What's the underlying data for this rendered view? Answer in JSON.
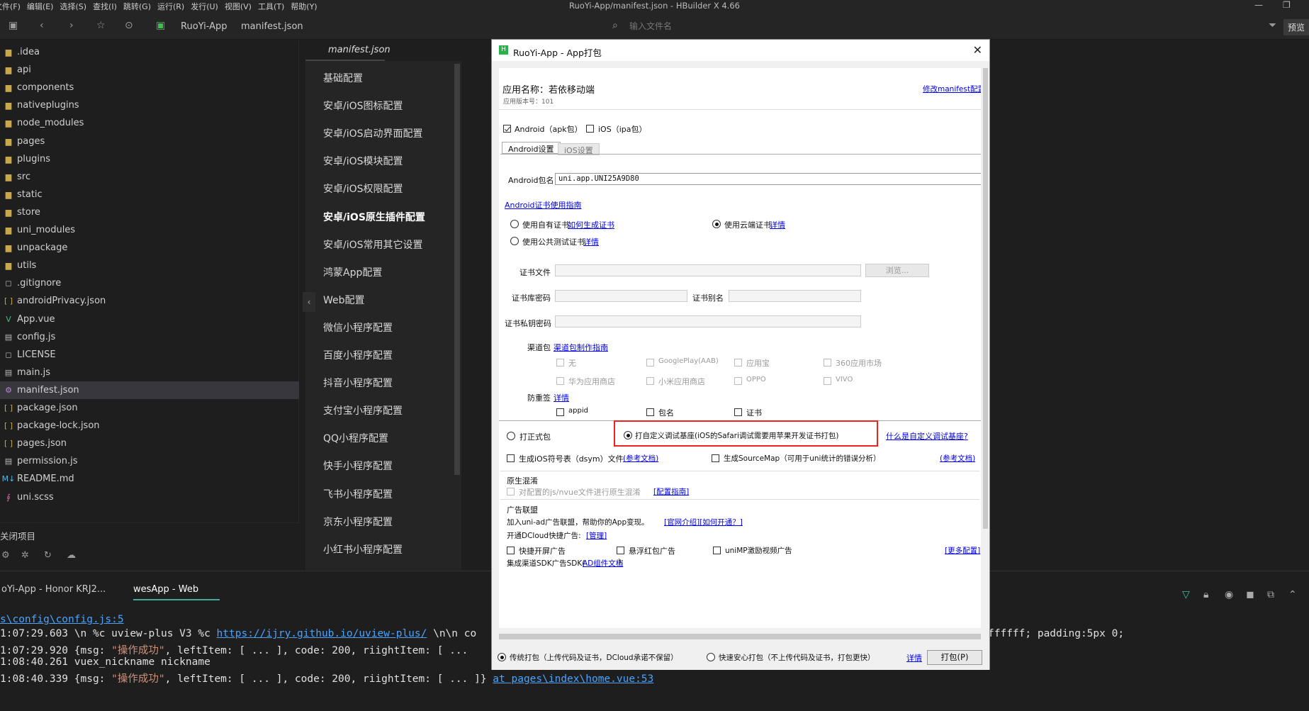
{
  "app": {
    "window_title": "RuoYi-App/manifest.json - HBuilder X 4.66",
    "menus": [
      "文件(F)",
      "编辑(E)",
      "选择(S)",
      "查找(I)",
      "跳转(G)",
      "运行(R)",
      "发行(U)",
      "视图(V)",
      "工具(T)",
      "帮助(Y)"
    ]
  },
  "toolbar": {
    "breadcrumb": [
      "RuoYi-App",
      "manifest.json"
    ],
    "search_placeholder": "输入文件名",
    "preview_label": "预览"
  },
  "sidebar": {
    "items": [
      {
        "name": ".idea",
        "icon": "folder-icon"
      },
      {
        "name": "api",
        "icon": "folder-icon"
      },
      {
        "name": "components",
        "icon": "folder-icon"
      },
      {
        "name": "nativeplugins",
        "icon": "folder-icon"
      },
      {
        "name": "node_modules",
        "icon": "folder-icon"
      },
      {
        "name": "pages",
        "icon": "folder-icon"
      },
      {
        "name": "plugins",
        "icon": "folder-icon"
      },
      {
        "name": "src",
        "icon": "folder-icon"
      },
      {
        "name": "static",
        "icon": "folder-icon"
      },
      {
        "name": "store",
        "icon": "folder-icon"
      },
      {
        "name": "uni_modules",
        "icon": "folder-icon"
      },
      {
        "name": "unpackage",
        "icon": "folder-icon"
      },
      {
        "name": "utils",
        "icon": "folder-icon"
      },
      {
        "name": ".gitignore",
        "icon": "file-icon"
      },
      {
        "name": "androidPrivacy.json",
        "icon": "json-icon"
      },
      {
        "name": "App.vue",
        "icon": "vue-icon"
      },
      {
        "name": "config.js",
        "icon": "js-icon"
      },
      {
        "name": "LICENSE",
        "icon": "file-icon"
      },
      {
        "name": "main.js",
        "icon": "js-icon"
      },
      {
        "name": "manifest.json",
        "icon": "manifest-icon"
      },
      {
        "name": "package.json",
        "icon": "json-icon"
      },
      {
        "name": "package-lock.json",
        "icon": "json-icon"
      },
      {
        "name": "pages.json",
        "icon": "json-icon"
      },
      {
        "name": "permission.js",
        "icon": "js-icon"
      },
      {
        "name": "README.md",
        "icon": "markdown-icon"
      },
      {
        "name": "uni.scss",
        "icon": "scss-icon"
      }
    ],
    "selected": "manifest.json",
    "footer_label": "关闭项目"
  },
  "editor": {
    "tab": "manifest.json",
    "nav": [
      "基础配置",
      "安卓/iOS图标配置",
      "安卓/iOS启动界面配置",
      "安卓/iOS模块配置",
      "安卓/iOS权限配置",
      "安卓/iOS原生插件配置",
      "安卓/iOS常用其它设置",
      "鸿蒙App配置",
      "Web配置",
      "微信小程序配置",
      "百度小程序配置",
      "抖音小程序配置",
      "支付宝小程序配置",
      "QQ小程序配置",
      "快手小程序配置",
      "飞书小程序配置",
      "京东小程序配置",
      "小红书小程序配置"
    ],
    "active_nav": "安卓/iOS原生插件配置"
  },
  "console": {
    "tabs": [
      "oYi-App - Honor KRJ2...",
      "wesApp - Web"
    ],
    "active_tab": "wesApp - Web",
    "lines": [
      {
        "prefix": "",
        "link": "s\\config\\config.js:5",
        "rest": ""
      },
      {
        "prefix": "1:07:29.603 \\n %c uview-plus V3 %c ",
        "link": "https://ijry.github.io/uview-plus/",
        "rest": " \\n\\n co"
      },
      {
        "prefix": "1:07:29.920 {msg: ",
        "str": "\"操作成功\"",
        "rest": ", leftItem: [ ... ], code: 200, riightItem: [ ..."
      },
      {
        "prefix": "1:08:40.261 vuex_nickname nickname",
        "link": "",
        "rest": ""
      },
      {
        "prefix": "1:08:40.339 {msg: ",
        "str": "\"操作成功\"",
        "rest": ", leftItem: [ ... ], code: 200, riightItem: [ ... ]} ",
        "link2": "at pages\\index\\home.vue:53"
      }
    ],
    "right_overflow": "ffffff; padding:5px 0;"
  },
  "dialog": {
    "title": "RuoYi-App - App打包",
    "app_name_label": "应用名称：若依移动端",
    "version_label": "应用版本号：101",
    "modify_link": "修改manifest配置",
    "platform_android": "Android（apk包）",
    "platform_ios": "iOS（ipa包）",
    "tab_android": "Android设置",
    "tab_ios": "iOS设置",
    "package_name_label": "Android包名",
    "package_name_value": "uni.app.UNI25A9D80",
    "cert_guide_link": "Android证书使用指南",
    "own_cert_label": "使用自有证书",
    "own_cert_link": "如何生成证书",
    "cloud_cert_label": "使用云端证书",
    "cloud_cert_link": "详情",
    "public_cert_label": "使用公共测试证书",
    "public_cert_link": "详情",
    "cert_file_label": "证书文件",
    "browse_label": "浏览...",
    "cert_pwd_label": "证书库密码",
    "cert_alias_label": "证书别名",
    "cert_key_label": "证书私钥密码",
    "channel_label": "渠道包",
    "channel_link": "渠道包制作指南",
    "channels": [
      "无",
      "GooglePlay(AAB)",
      "应用宝",
      "360应用市场",
      "华为应用商店",
      "小米应用商店",
      "OPPO",
      "VIVO"
    ],
    "antiresign_label": "防重签",
    "antiresign_link": "详情",
    "antiresign_opts": [
      "appid",
      "包名",
      "证书"
    ],
    "formal_label": "打正式包",
    "custom_base_label": "打自定义调试基座(iOS的Safari调试需要用苹果开发证书打包)",
    "custom_base_link": "什么是自定义调试基座?",
    "dsym_label": "生成iOS符号表（dsym）文件",
    "dsym_link": "(参考文档)",
    "sourcemap_label": "生成SourceMap（可用于uni统计的错误分析）",
    "sourcemap_link": "(参考文档)",
    "obfuscation_title": "原生混淆",
    "obfuscation_label": "对配置的js/nvue文件进行原生混淆",
    "obfuscation_link": "[配置指南]",
    "ad_title": "广告联盟",
    "ad_join_text": "加入uni-ad广告联盟，帮助你的App变现。",
    "ad_join_links": "[官网介绍][如何开通？]",
    "dcloud_ad_label": "开通DCloud快捷广告:",
    "dcloud_ad_link": "[管理]",
    "ad_splash": "快捷开屏广告",
    "ad_redpack": "悬浮红包广告",
    "ad_video": "uniMP激励视频广告",
    "ad_more_link": "[更多配置]",
    "ad_sdk_label": "集成渠道SDK广告SDK(",
    "ad_sdk_link": "AD组件文档",
    "ad_sdk_tail": "):",
    "traditional_pack": "传统打包（上传代码及证书，DCloud承诺不保留）",
    "fast_pack": "快速安心打包（不上传代码及证书，打包更快）",
    "fast_pack_link": "详情",
    "pack_button": "打包(P)"
  }
}
